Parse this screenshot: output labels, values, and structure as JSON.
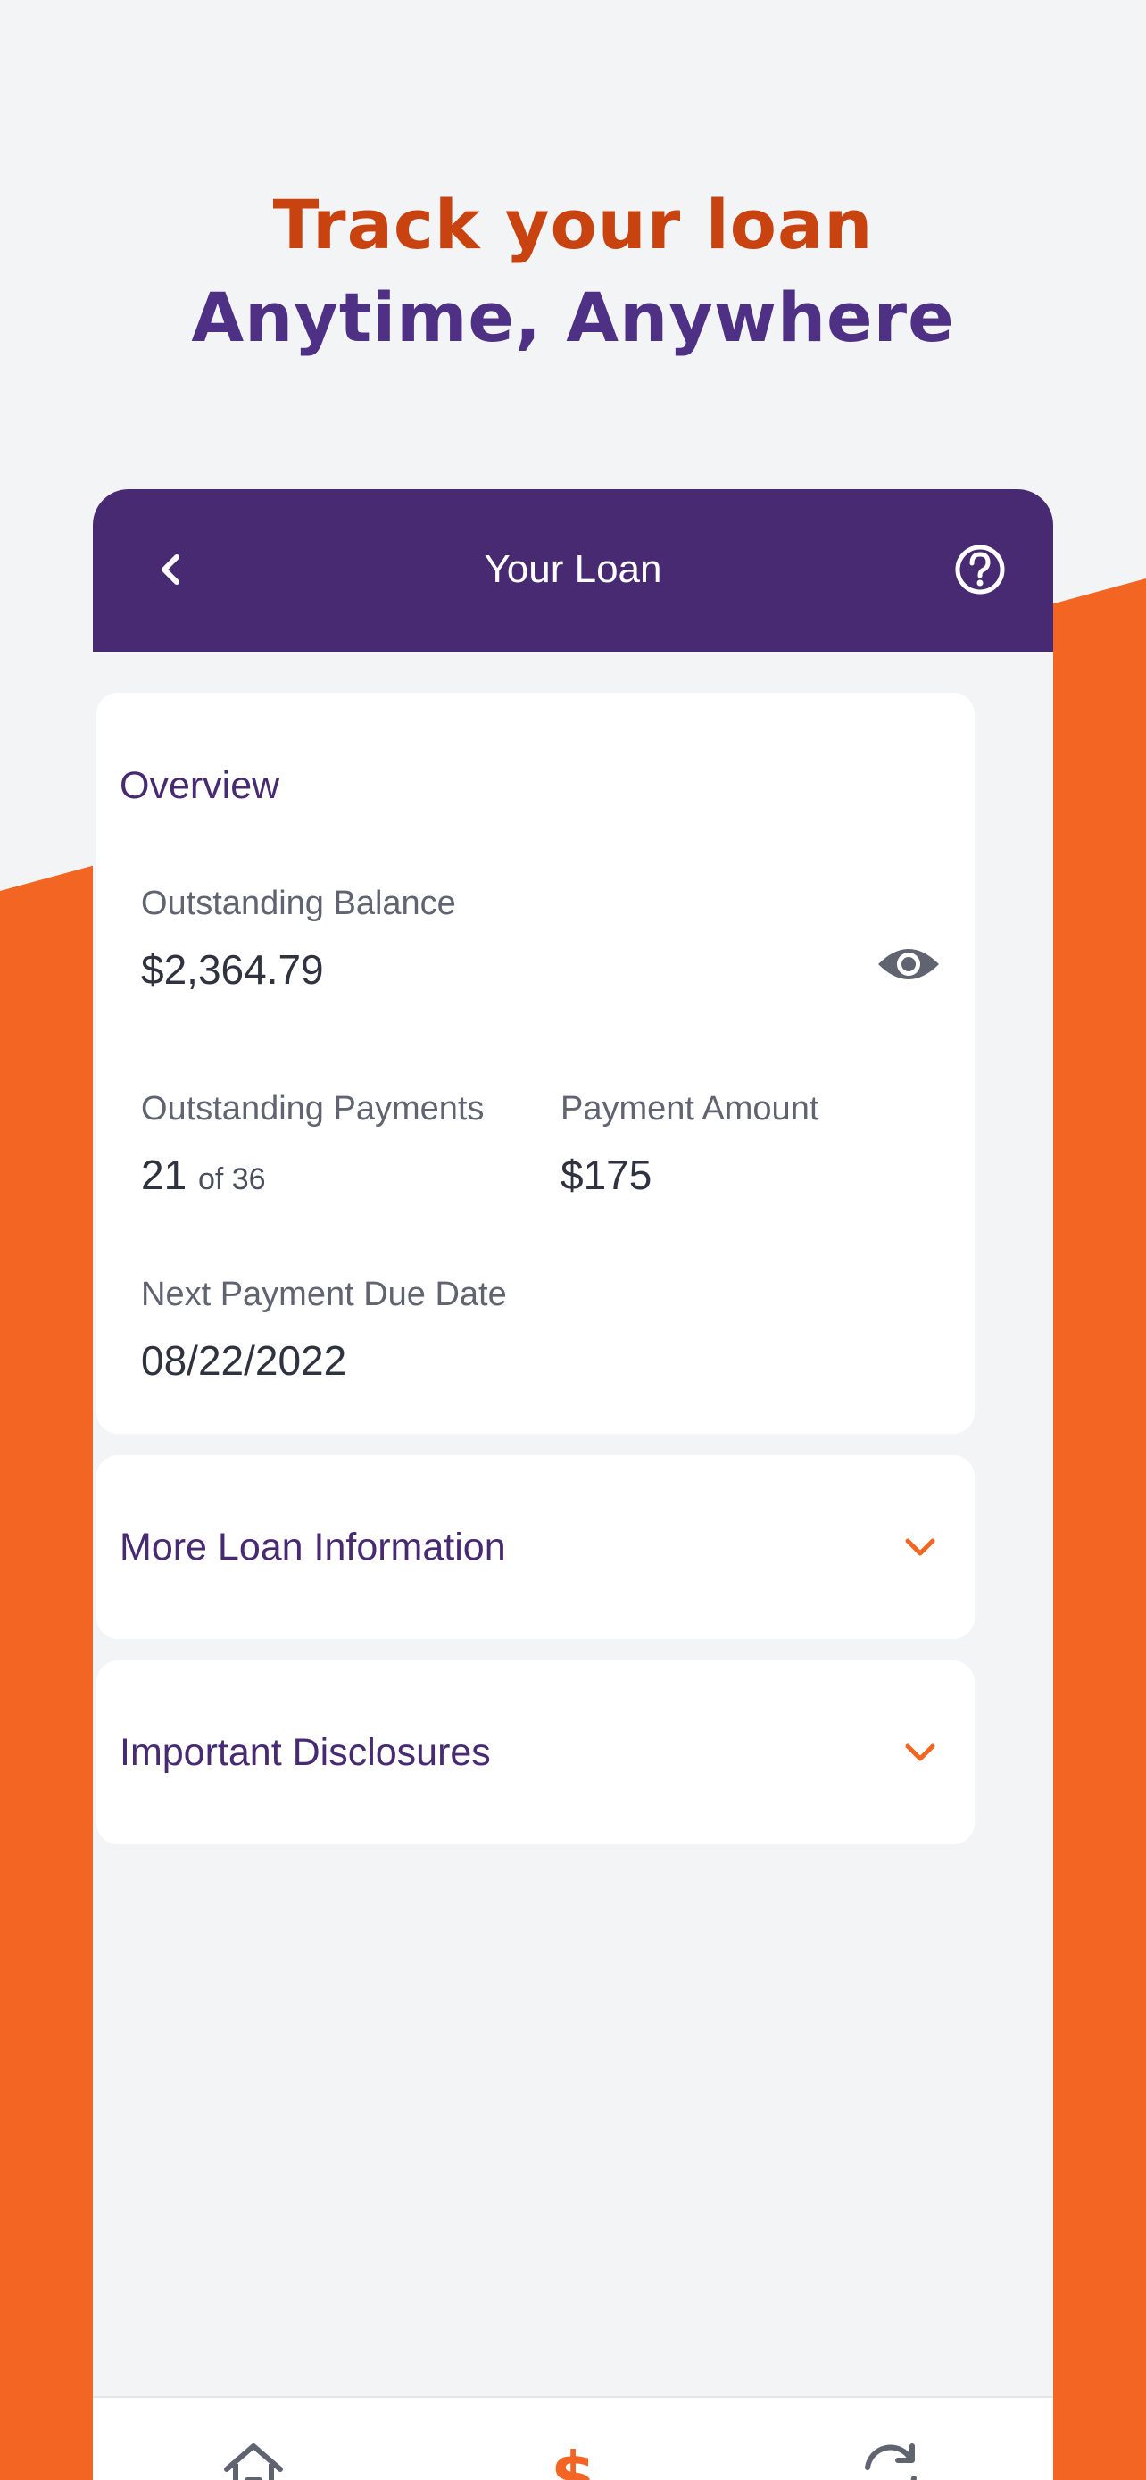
{
  "hero": {
    "line1": "Track your loan",
    "line2": "Anytime, Anywhere"
  },
  "appbar": {
    "title": "Your Loan",
    "back_icon": "chevron-left-icon",
    "help_icon": "help-circle-icon"
  },
  "overview": {
    "title": "Overview",
    "balance_label": "Outstanding Balance",
    "balance_value": "$2,364.79",
    "eye_icon": "eye-icon",
    "payments_label": "Outstanding Payments",
    "payments_value": "21",
    "payments_total": "of 36",
    "amount_label": "Payment Amount",
    "amount_value": "$175",
    "due_label": "Next Payment Due Date",
    "due_value": "08/22/2022"
  },
  "sections": {
    "more_info": "More Loan Information",
    "disclosures": "Important Disclosures"
  },
  "tabbar": {
    "items": [
      "home-icon",
      "dollar-icon",
      "refresh-icon"
    ],
    "active": "dollar-icon"
  },
  "colors": {
    "brand_purple": "#472a72",
    "brand_orange": "#f26522",
    "hero_orange": "#c8430f",
    "hero_purple": "#4e3184",
    "background": "#f3f4f6"
  }
}
